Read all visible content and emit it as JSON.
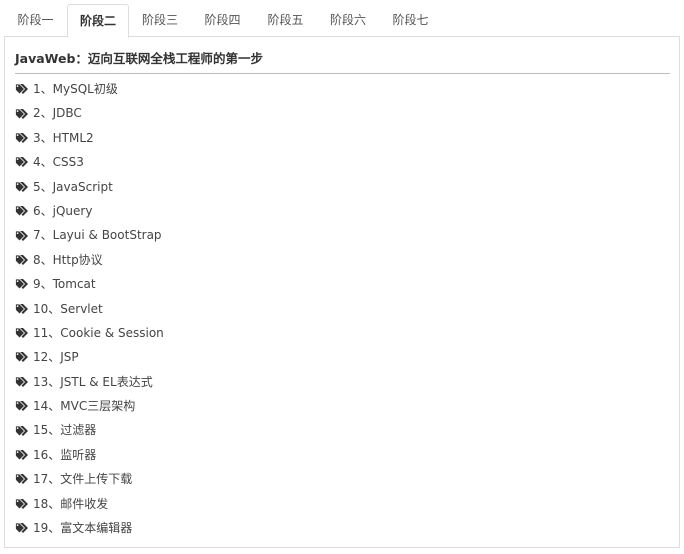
{
  "tabs": [
    {
      "label": "阶段一",
      "active": false
    },
    {
      "label": "阶段二",
      "active": true
    },
    {
      "label": "阶段三",
      "active": false
    },
    {
      "label": "阶段四",
      "active": false
    },
    {
      "label": "阶段五",
      "active": false
    },
    {
      "label": "阶段六",
      "active": false
    },
    {
      "label": "阶段七",
      "active": false
    }
  ],
  "panel": {
    "title": "JavaWeb：迈向互联网全栈工程师的第一步",
    "item_icon": "tags-icon",
    "items": [
      "1、MySQL初级",
      "2、JDBC",
      "3、HTML2",
      "4、CSS3",
      "5、JavaScript",
      "6、jQuery",
      "7、Layui & BootStrap",
      "8、Http协议",
      "9、Tomcat",
      "10、Servlet",
      "11、Cookie & Session",
      "12、JSP",
      "13、JSTL & EL表达式",
      "14、MVC三层架构",
      "15、过滤器",
      "16、监听器",
      "17、文件上传下载",
      "18、邮件收发",
      "19、富文本编辑器"
    ]
  }
}
